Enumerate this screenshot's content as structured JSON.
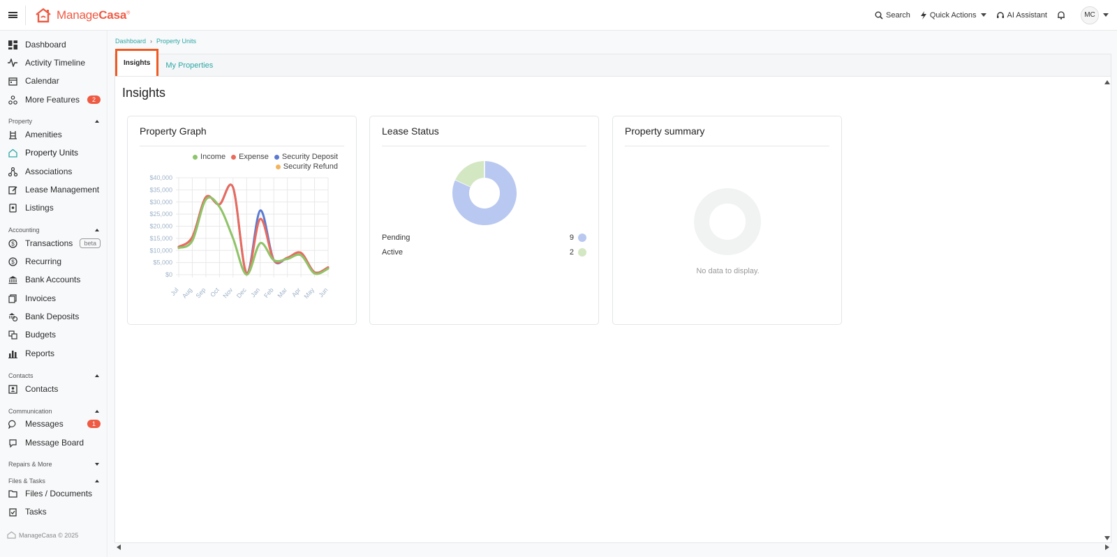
{
  "app": {
    "brand_prefix": "Manage",
    "brand_suffix": "Casa",
    "brand_mark": "®"
  },
  "topbar": {
    "search_label": "Search",
    "quick_actions_label": "Quick Actions",
    "ai_label": "AI Assistant",
    "avatar_initials": "MC"
  },
  "sidebar": {
    "items_top": [
      {
        "label": "Dashboard",
        "icon": "dashboard-icon"
      },
      {
        "label": "Activity Timeline",
        "icon": "pulse-icon"
      },
      {
        "label": "Calendar",
        "icon": "calendar-icon"
      },
      {
        "label": "More Features",
        "icon": "features-icon",
        "badge": "2"
      }
    ],
    "section_property": "Property",
    "items_property": [
      {
        "label": "Amenities",
        "icon": "amenities-icon"
      },
      {
        "label": "Property Units",
        "icon": "home-icon"
      },
      {
        "label": "Associations",
        "icon": "associations-icon"
      },
      {
        "label": "Lease Management",
        "icon": "lease-icon"
      },
      {
        "label": "Listings",
        "icon": "listings-icon"
      }
    ],
    "section_accounting": "Accounting",
    "items_accounting": [
      {
        "label": "Transactions",
        "icon": "dollar-icon",
        "tag": "beta"
      },
      {
        "label": "Recurring",
        "icon": "recurring-icon"
      },
      {
        "label": "Bank Accounts",
        "icon": "bank-icon"
      },
      {
        "label": "Invoices",
        "icon": "invoice-icon"
      },
      {
        "label": "Bank Deposits",
        "icon": "deposit-icon"
      },
      {
        "label": "Budgets",
        "icon": "budget-icon"
      },
      {
        "label": "Reports",
        "icon": "reports-icon"
      }
    ],
    "section_contacts": "Contacts",
    "items_contacts": [
      {
        "label": "Contacts",
        "icon": "contacts-icon"
      }
    ],
    "section_communication": "Communication",
    "items_communication": [
      {
        "label": "Messages",
        "icon": "message-icon",
        "badge": "1"
      },
      {
        "label": "Message Board",
        "icon": "board-icon"
      }
    ],
    "section_repairs": "Repairs & More",
    "section_files": "Files & Tasks",
    "items_files": [
      {
        "label": "Files / Documents",
        "icon": "folder-icon"
      },
      {
        "label": "Tasks",
        "icon": "tasks-icon"
      }
    ],
    "footer_brand": "ManageCasa",
    "footer_year": "© 2025"
  },
  "breadcrumb": {
    "home": "Dashboard",
    "current": "Property Units"
  },
  "tabs": {
    "insights": "Insights",
    "my_properties": "My Properties"
  },
  "page": {
    "title": "Insights"
  },
  "cards": {
    "property_graph": "Property Graph",
    "lease_status": "Lease Status",
    "property_summary": "Property summary",
    "no_data": "No data to display."
  },
  "colors": {
    "income": "#8cc56b",
    "expense": "#ea6a5c",
    "security_deposit": "#5a7bd1",
    "security_refund": "#f3b35b",
    "pending": "#b9c8f0",
    "active": "#d4e7c3",
    "accent": "#2fa6a6",
    "brand": "#ef5a43"
  },
  "chart_data": [
    {
      "type": "line",
      "title": "Property Graph",
      "categories": [
        "Jul",
        "Aug",
        "Sep",
        "Oct",
        "Nov",
        "Dec",
        "Jan",
        "Feb",
        "Mar",
        "Apr",
        "May",
        "Jun"
      ],
      "yticks": [
        "$40,000",
        "$35,000",
        "$30,000",
        "$25,000",
        "$20,000",
        "$15,000",
        "$10,000",
        "$5,000",
        "$0"
      ],
      "ylim": [
        0,
        40000
      ],
      "grid": true,
      "legend_position": "top-right",
      "series": [
        {
          "name": "Income",
          "values": [
            11000,
            14000,
            31000,
            28000,
            15000,
            0,
            13000,
            6000,
            6500,
            8000,
            500,
            2500
          ]
        },
        {
          "name": "Expense",
          "values": [
            11500,
            15500,
            32000,
            29000,
            36000,
            500,
            23000,
            6000,
            7000,
            9000,
            1000,
            3000
          ]
        },
        {
          "name": "Security Deposit",
          "values": [
            11500,
            15500,
            32000,
            29000,
            36000,
            500,
            26500,
            6000,
            7000,
            9000,
            1000,
            3000
          ]
        },
        {
          "name": "Security Refund",
          "values": [
            11000,
            14000,
            31000,
            28000,
            15000,
            0,
            13000,
            6000,
            6500,
            8000,
            500,
            2500
          ]
        }
      ]
    },
    {
      "type": "pie",
      "title": "Lease Status",
      "categories": [
        "Pending",
        "Active"
      ],
      "values": [
        9,
        2
      ]
    }
  ]
}
